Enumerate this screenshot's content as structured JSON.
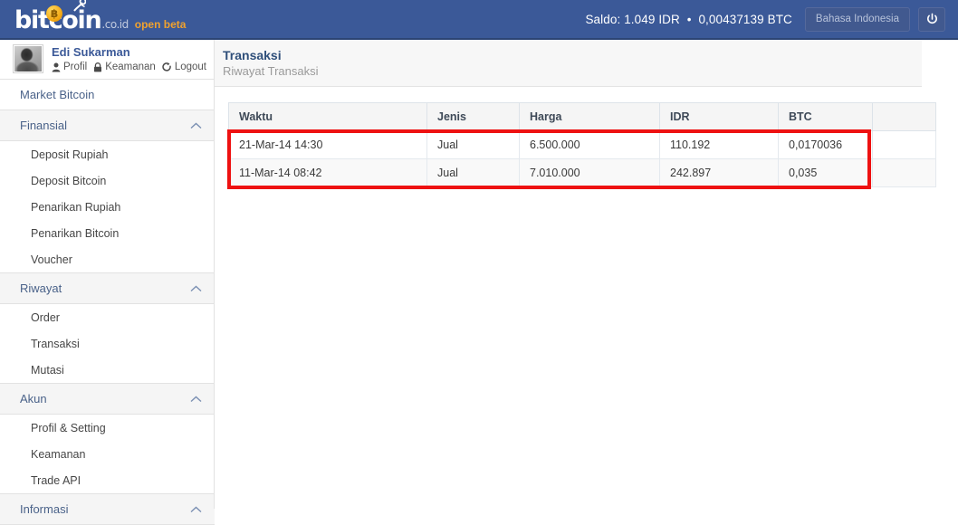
{
  "navbar": {
    "brand": {
      "word": "bitcoin",
      "coin_symbol": "฿",
      "tld": ".co.id",
      "beta": "open beta"
    },
    "balance_label": "Saldo:",
    "balance_idr": "1.049 IDR",
    "separator": "•",
    "balance_btc": "0,00437139 BTC",
    "language_button": "Bahasa Indonesia",
    "power_icon": "power-icon"
  },
  "user": {
    "name": "Edi Sukarman",
    "links": [
      {
        "label": "Profil",
        "icon": "person-icon"
      },
      {
        "label": "Keamanan",
        "icon": "lock-icon"
      },
      {
        "label": "Logout",
        "icon": "logout-icon"
      }
    ]
  },
  "sidebar": {
    "sections": [
      {
        "id": "market-bitcoin",
        "label": "Market Bitcoin",
        "type": "plain",
        "collapsible": false,
        "items": []
      },
      {
        "id": "finansial",
        "label": "Finansial",
        "type": "group",
        "collapsible": true,
        "chevron": "chevron-up-icon",
        "items": [
          {
            "id": "deposit-rupiah",
            "label": "Deposit Rupiah"
          },
          {
            "id": "deposit-bitcoin",
            "label": "Deposit Bitcoin"
          },
          {
            "id": "penarikan-rupiah",
            "label": "Penarikan Rupiah"
          },
          {
            "id": "penarikan-bitcoin",
            "label": "Penarikan Bitcoin"
          },
          {
            "id": "voucher",
            "label": "Voucher"
          }
        ]
      },
      {
        "id": "riwayat",
        "label": "Riwayat",
        "type": "group",
        "collapsible": true,
        "chevron": "chevron-up-icon",
        "items": [
          {
            "id": "order",
            "label": "Order"
          },
          {
            "id": "transaksi",
            "label": "Transaksi"
          },
          {
            "id": "mutasi",
            "label": "Mutasi"
          }
        ]
      },
      {
        "id": "akun",
        "label": "Akun",
        "type": "group",
        "collapsible": true,
        "chevron": "chevron-up-icon",
        "items": [
          {
            "id": "profil-setting",
            "label": "Profil & Setting"
          },
          {
            "id": "keamanan",
            "label": "Keamanan"
          },
          {
            "id": "trade-api",
            "label": "Trade API"
          }
        ]
      },
      {
        "id": "informasi",
        "label": "Informasi",
        "type": "group",
        "collapsible": true,
        "chevron": "chevron-up-icon",
        "items": []
      }
    ]
  },
  "page": {
    "title": "Transaksi",
    "subtitle": "Riwayat Transaksi"
  },
  "table": {
    "columns": [
      "Waktu",
      "Jenis",
      "Harga",
      "IDR",
      "BTC",
      ""
    ],
    "rows": [
      {
        "waktu": "21-Mar-14 14:30",
        "jenis": "Jual",
        "harga": "6.500.000",
        "idr": "110.192",
        "btc": "0,0170036",
        "extra": ""
      },
      {
        "waktu": "11-Mar-14 08:42",
        "jenis": "Jual",
        "harga": "7.010.000",
        "idr": "242.897",
        "btc": "0,035",
        "extra": ""
      }
    ]
  },
  "annotation": {
    "type": "rectangle-highlight",
    "color": "#ee1111",
    "covers": "transaction-rows"
  },
  "colors": {
    "navbar_blue": "#3b5998",
    "brand_orange": "#f0a22e",
    "title_navy": "#2f4f7a",
    "annotation_red": "#ee1111"
  }
}
